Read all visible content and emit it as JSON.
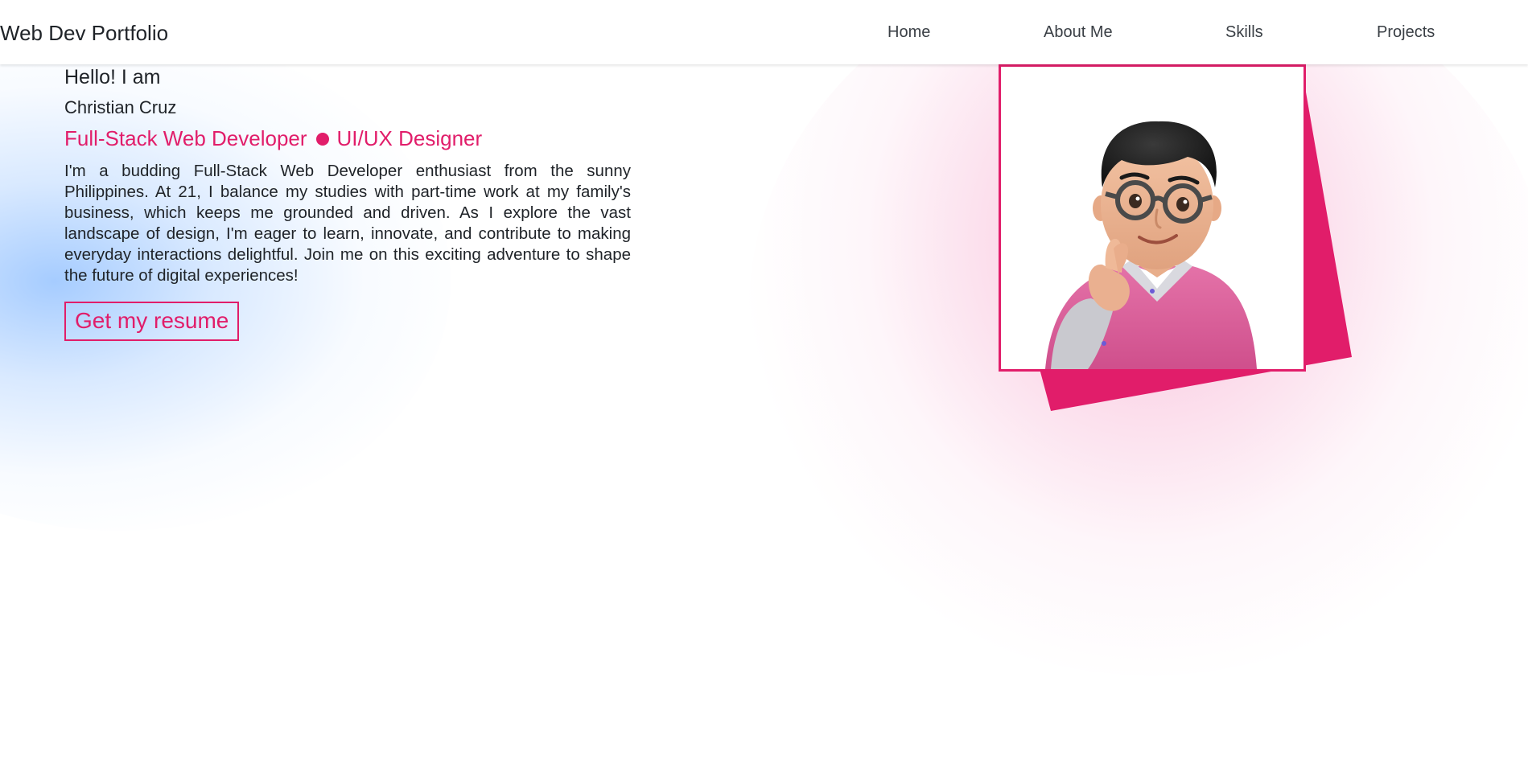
{
  "navbar": {
    "brand": "Web Dev Portfolio",
    "links": [
      "Home",
      "About Me",
      "Skills",
      "Projects"
    ]
  },
  "hero": {
    "greeting": "Hello! I am",
    "name": "Christian Cruz",
    "role_primary": "Full-Stack Web Developer",
    "role_secondary": "UI/UX Designer",
    "bio": "I'm a budding Full-Stack Web Developer enthusiast from the sunny Philippines. At 21, I balance my studies with part-time work at my family's business, which keeps me grounded and driven. As I explore the vast landscape of design, I'm eager to learn, innovate, and contribute to making everyday interactions delightful. Join me on this exciting adventure to shape the future of digital experiences!",
    "resume_label": "Get my resume"
  },
  "theme": {
    "accent": "#e11d6a",
    "text": "#1f2328",
    "blue_glow": "#9fc4ff",
    "pink_glow": "#f17bb5"
  },
  "icons": {
    "dot": "bullet-dot-icon",
    "avatar": "memoji-avatar"
  }
}
